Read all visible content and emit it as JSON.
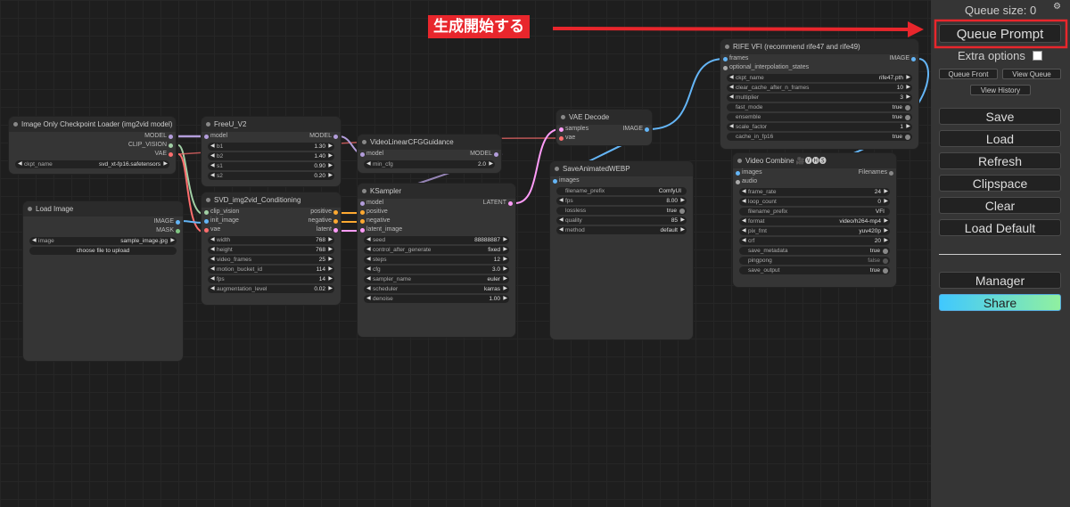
{
  "annotation": {
    "label": "生成開始する",
    "color": "#e8262c"
  },
  "panel": {
    "queue_size": "Queue size: 0",
    "queue_prompt": "Queue Prompt",
    "extra_options": "Extra options",
    "queue_front": "Queue Front",
    "view_queue": "View Queue",
    "view_history": "View History",
    "save": "Save",
    "load": "Load",
    "refresh": "Refresh",
    "clipspace": "Clipspace",
    "clear": "Clear",
    "load_default": "Load Default",
    "manager": "Manager",
    "share": "Share",
    "gear_icon": "gear-icon"
  },
  "nodes": {
    "checkpoint": {
      "title": "Image Only Checkpoint Loader (img2vid model)",
      "outputs": [
        "MODEL",
        "CLIP_VISION",
        "VAE"
      ],
      "ckpt_label": "ckpt_name",
      "ckpt_value": "svd_xt-fp16.safetensors"
    },
    "load_image": {
      "title": "Load Image",
      "outputs": [
        "IMAGE",
        "MASK"
      ],
      "image_label": "image",
      "image_value": "sample_image.jpg",
      "upload": "choose file to upload"
    },
    "freeu": {
      "title": "FreeU_V2",
      "input": "model",
      "output": "MODEL",
      "widgets": [
        {
          "l": "b1",
          "v": "1.30"
        },
        {
          "l": "b2",
          "v": "1.40"
        },
        {
          "l": "s1",
          "v": "0.90"
        },
        {
          "l": "s2",
          "v": "0.20"
        }
      ]
    },
    "svd": {
      "title": "SVD_img2vid_Conditioning",
      "inputs": [
        "clip_vision",
        "init_image",
        "vae"
      ],
      "outputs": [
        "positive",
        "negative",
        "latent"
      ],
      "widgets": [
        {
          "l": "width",
          "v": "768"
        },
        {
          "l": "height",
          "v": "768"
        },
        {
          "l": "video_frames",
          "v": "25"
        },
        {
          "l": "motion_bucket_id",
          "v": "114"
        },
        {
          "l": "fps",
          "v": "14"
        },
        {
          "l": "augmentation_level",
          "v": "0.02"
        }
      ]
    },
    "vlcfg": {
      "title": "VideoLinearCFGGuidance",
      "input": "model",
      "output": "MODEL",
      "widgets": [
        {
          "l": "min_cfg",
          "v": "2.0"
        }
      ]
    },
    "ksampler": {
      "title": "KSampler",
      "inputs": [
        "model",
        "positive",
        "negative",
        "latent_image"
      ],
      "output": "LATENT",
      "widgets": [
        {
          "l": "seed",
          "v": "88888887"
        },
        {
          "l": "control_after_generate",
          "v": "fixed"
        },
        {
          "l": "steps",
          "v": "12"
        },
        {
          "l": "cfg",
          "v": "3.0"
        },
        {
          "l": "sampler_name",
          "v": "euler"
        },
        {
          "l": "scheduler",
          "v": "karras"
        },
        {
          "l": "denoise",
          "v": "1.00"
        }
      ]
    },
    "vae_decode": {
      "title": "VAE Decode",
      "inputs": [
        "samples",
        "vae"
      ],
      "output": "IMAGE"
    },
    "save_webp": {
      "title": "SaveAnimatedWEBP",
      "input": "images",
      "widgets": [
        {
          "l": "filename_prefix",
          "v": "ComfyUI",
          "t": "text"
        },
        {
          "l": "fps",
          "v": "8.00"
        },
        {
          "l": "lossless",
          "v": "true",
          "t": "toggle"
        },
        {
          "l": "quality",
          "v": "85"
        },
        {
          "l": "method",
          "v": "default"
        }
      ]
    },
    "rife": {
      "title": "RIFE VFI (recommend rife47 and rife49)",
      "inputs": [
        "frames",
        "optional_interpolation_states"
      ],
      "output": "IMAGE",
      "widgets": [
        {
          "l": "ckpt_name",
          "v": "rife47.pth"
        },
        {
          "l": "clear_cache_after_n_frames",
          "v": "10"
        },
        {
          "l": "multiplier",
          "v": "3"
        },
        {
          "l": "fast_mode",
          "v": "true",
          "t": "toggle"
        },
        {
          "l": "ensemble",
          "v": "true",
          "t": "toggle"
        },
        {
          "l": "scale_factor",
          "v": "1"
        },
        {
          "l": "cache_in_fp16",
          "v": "true",
          "t": "toggle"
        }
      ]
    },
    "video_combine": {
      "title": "Video Combine 🎥🅥🅗🅢",
      "inputs": [
        "images",
        "audio"
      ],
      "output": "Filenames",
      "widgets": [
        {
          "l": "frame_rate",
          "v": "24"
        },
        {
          "l": "loop_count",
          "v": "0"
        },
        {
          "l": "filename_prefix",
          "v": "VFI",
          "t": "text"
        },
        {
          "l": "format",
          "v": "video/h264-mp4"
        },
        {
          "l": "pix_fmt",
          "v": "yuv420p"
        },
        {
          "l": "crf",
          "v": "20"
        },
        {
          "l": "save_metadata",
          "v": "true",
          "t": "toggle"
        },
        {
          "l": "pingpong",
          "v": "false",
          "t": "toggle"
        },
        {
          "l": "save_output",
          "v": "true",
          "t": "toggle"
        }
      ]
    }
  },
  "colors": {
    "model": "#b39ddb",
    "clip_vision": "#a1cfa5",
    "vae": "#ff6e6e",
    "image": "#64b5f6",
    "conditioning": "#ffa931",
    "latent": "#ff9cf9",
    "share_start": "#40c8ff",
    "share_end": "#90f0a0"
  }
}
